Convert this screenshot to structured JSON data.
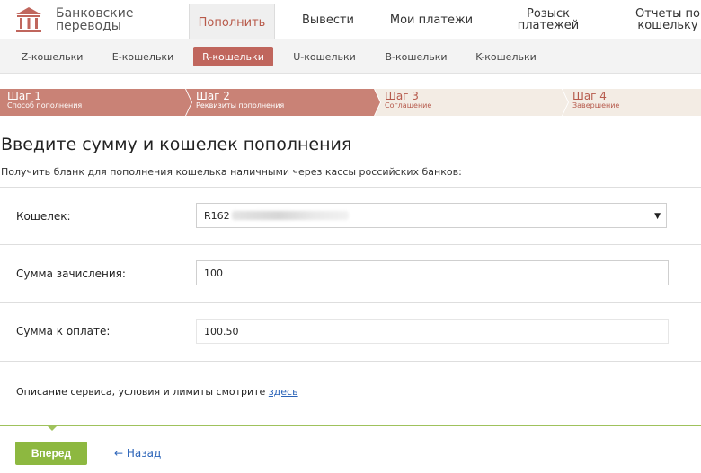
{
  "brand": {
    "line1": "Банковские",
    "line2": "переводы"
  },
  "topnav": [
    {
      "line1": "Пополнить",
      "line2": ""
    },
    {
      "line1": "Вывести",
      "line2": ""
    },
    {
      "line1": "Мои платежи",
      "line2": ""
    },
    {
      "line1": "Розыск",
      "line2": "платежей"
    },
    {
      "line1": "Отчеты по",
      "line2": "кошельку"
    }
  ],
  "subnav": [
    "Z-кошельки",
    "E-кошельки",
    "R-кошельки",
    "U-кошельки",
    "B-кошельки",
    "K-кошельки"
  ],
  "steps": [
    {
      "title": "Шаг 1",
      "sub": "Способ пополнения"
    },
    {
      "title": "Шаг 2",
      "sub": "Реквизиты пополнения"
    },
    {
      "title": "Шаг 3",
      "sub": "Соглашение"
    },
    {
      "title": "Шаг 4",
      "sub": "Завершение"
    }
  ],
  "main": {
    "title": "Введите сумму и кошелек пополнения",
    "subtitle": "Получить бланк для пополнения кошелька наличными через кассы российских банков:",
    "wallet_label": "Кошелек:",
    "wallet_value": "R162",
    "amount_label": "Сумма зачисления:",
    "amount_value": "100",
    "pay_label": "Сумма к оплате:",
    "pay_value": "100.50",
    "note_text": "Описание сервиса, условия и лимиты смотрите ",
    "note_link": "здесь"
  },
  "footer": {
    "next": "Вперед",
    "back": "← Назад"
  },
  "colors": {
    "accent": "#c0665d",
    "green": "#8db840",
    "link": "#2a63b8"
  }
}
